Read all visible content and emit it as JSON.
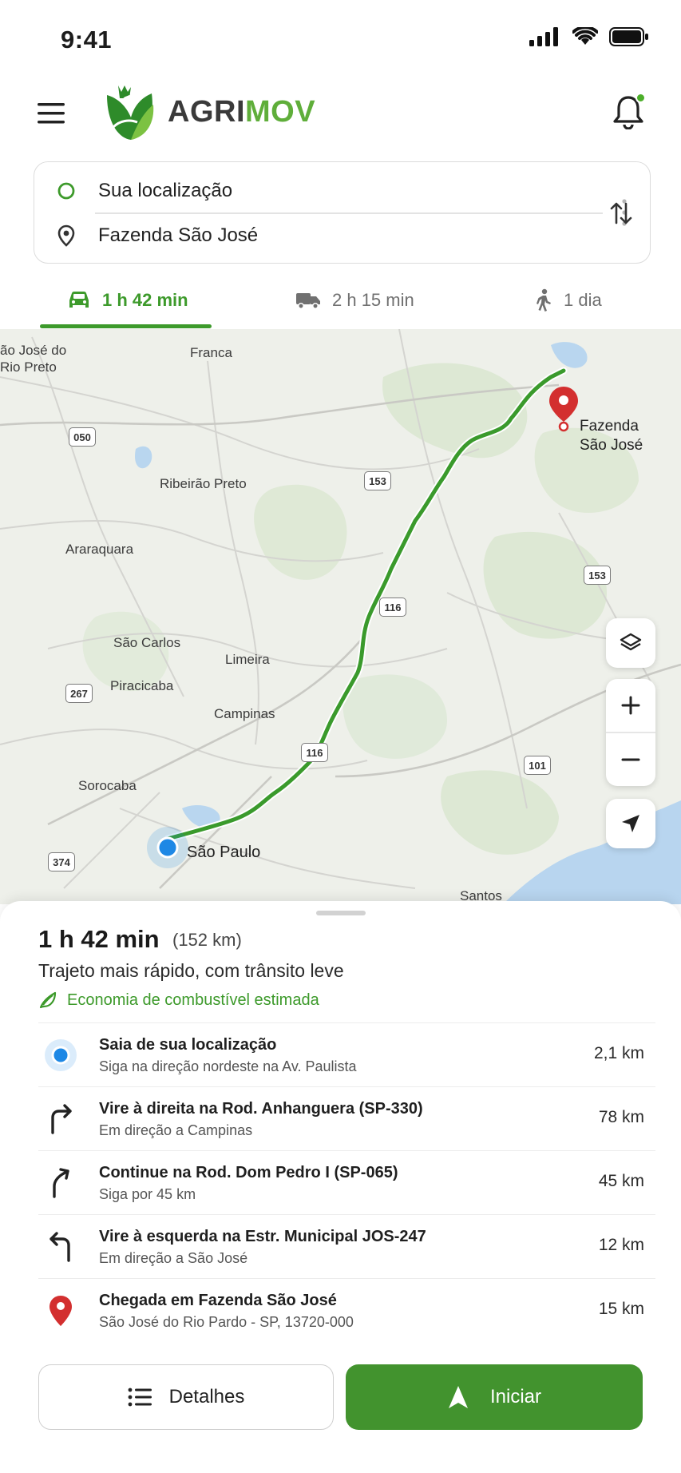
{
  "status_bar": {
    "time": "9:41"
  },
  "header": {
    "logo_part1": "AGRI",
    "logo_part2": "MOV"
  },
  "route": {
    "origin": "Sua localização",
    "destination": "Fazenda São José"
  },
  "modes": [
    {
      "icon": "car-icon",
      "label": "1 h 42 min",
      "active": true
    },
    {
      "icon": "truck-icon",
      "label": "2 h 15 min",
      "active": false
    },
    {
      "icon": "walk-icon",
      "label": "1 dia",
      "active": false
    }
  ],
  "map": {
    "labels": {
      "sjrp": "ão José do\nRio Preto",
      "franca": "Franca",
      "ribeirao": "Ribeirão Preto",
      "araraquara": "Araraquara",
      "saocarlos": "São Carlos",
      "limeira": "Limeira",
      "piracicaba": "Piracicaba",
      "campinas": "Campinas",
      "sorocaba": "Sorocaba",
      "saopaulo": "São Paulo",
      "santos": "Santos"
    },
    "shields": {
      "r050": "050",
      "r153a": "153",
      "r153b": "153",
      "r116a": "116",
      "r116b": "116",
      "r267": "267",
      "r374": "374",
      "r101": "101"
    },
    "destination_label_line1": "Fazenda",
    "destination_label_line2": "São José"
  },
  "summary": {
    "time": "1 h 42 min",
    "distance": "(152 km)",
    "description": "Trajeto mais rápido, com trânsito leve",
    "eco": "Economia de combustível estimada"
  },
  "steps": [
    {
      "icon": "origin-dot-icon",
      "title": "Saia de sua localização",
      "sub": "Siga na direção nordeste na Av. Paulista",
      "dist": "2,1 km"
    },
    {
      "icon": "turn-right-icon",
      "title": "Vire à direita na Rod. Anhanguera (SP-330)",
      "sub": "Em direção a Campinas",
      "dist": "78 km"
    },
    {
      "icon": "continue-icon",
      "title": "Continue na Rod. Dom Pedro I (SP-065)",
      "sub": "Siga por 45 km",
      "dist": "45 km"
    },
    {
      "icon": "turn-left-icon",
      "title": "Vire à esquerda na Estr. Municipal JOS-247",
      "sub": "Em direção a São José",
      "dist": "12 km"
    },
    {
      "icon": "destination-pin-icon",
      "title": "Chegada em Fazenda São José",
      "sub": "São José do Rio Pardo - SP, 13720-000",
      "dist": "15 km"
    }
  ],
  "buttons": {
    "details": "Detalhes",
    "start": "Iniciar"
  },
  "colors": {
    "brand_green": "#3d9a2b",
    "route_green": "#3a9a2c",
    "pin_red": "#d32f2f",
    "origin_blue": "#1e88e5"
  }
}
